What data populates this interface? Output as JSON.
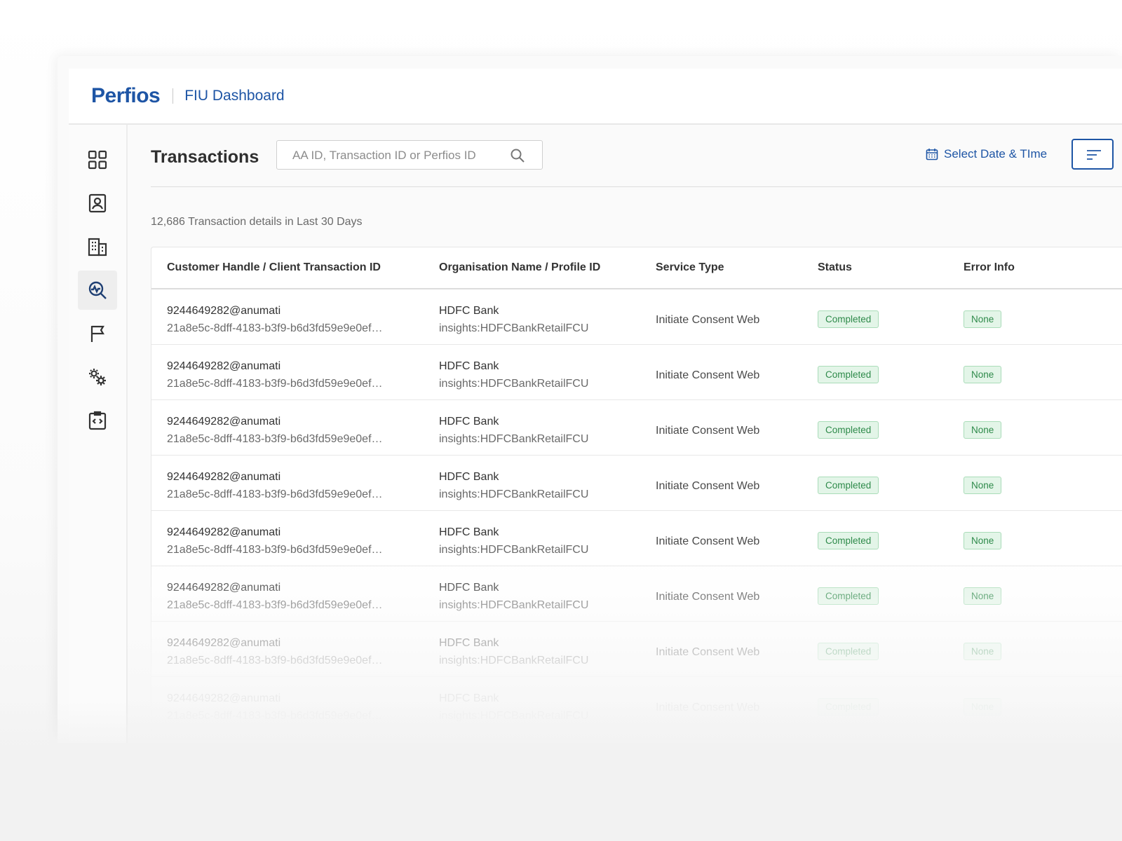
{
  "header": {
    "logo_text": "Perfios",
    "app_title": "FIU Dashboard"
  },
  "sidebar": {
    "items": [
      {
        "name": "dashboard",
        "icon": "grid-icon",
        "active": false
      },
      {
        "name": "customers",
        "icon": "user-profile-icon",
        "active": false
      },
      {
        "name": "organisations",
        "icon": "building-icon",
        "active": false
      },
      {
        "name": "transactions",
        "icon": "transaction-search-icon",
        "active": true
      },
      {
        "name": "reports",
        "icon": "flag-icon",
        "active": false
      },
      {
        "name": "settings",
        "icon": "gears-icon",
        "active": false
      },
      {
        "name": "developer",
        "icon": "code-clipboard-icon",
        "active": false
      }
    ]
  },
  "main": {
    "page_title": "Transactions",
    "search_placeholder": "AA ID, Transaction ID or Perfios ID",
    "date_button_label": "Select Date & TIme",
    "summary": "12,686 Transaction details in Last 30 Days"
  },
  "table": {
    "columns": [
      "Customer Handle / Client Transaction ID",
      "Organisation Name / Profile ID",
      "Service Type",
      "Status",
      "Error Info"
    ],
    "rows": [
      {
        "handle": "9244649282@anumati",
        "txn_id": "21a8e5c-8dff-4183-b3f9-b6d3fd59e9e0ef…",
        "org": "HDFC Bank",
        "profile": "insights:HDFCBankRetailFCU",
        "service": "Initiate Consent Web",
        "status": "Completed",
        "error": "None"
      },
      {
        "handle": "9244649282@anumati",
        "txn_id": "21a8e5c-8dff-4183-b3f9-b6d3fd59e9e0ef…",
        "org": "HDFC Bank",
        "profile": "insights:HDFCBankRetailFCU",
        "service": "Initiate Consent Web",
        "status": "Completed",
        "error": "None"
      },
      {
        "handle": "9244649282@anumati",
        "txn_id": "21a8e5c-8dff-4183-b3f9-b6d3fd59e9e0ef…",
        "org": "HDFC Bank",
        "profile": "insights:HDFCBankRetailFCU",
        "service": "Initiate Consent Web",
        "status": "Completed",
        "error": "None"
      },
      {
        "handle": "9244649282@anumati",
        "txn_id": "21a8e5c-8dff-4183-b3f9-b6d3fd59e9e0ef…",
        "org": "HDFC Bank",
        "profile": "insights:HDFCBankRetailFCU",
        "service": "Initiate Consent Web",
        "status": "Completed",
        "error": "None"
      },
      {
        "handle": "9244649282@anumati",
        "txn_id": "21a8e5c-8dff-4183-b3f9-b6d3fd59e9e0ef…",
        "org": "HDFC Bank",
        "profile": "insights:HDFCBankRetailFCU",
        "service": "Initiate Consent Web",
        "status": "Completed",
        "error": "None"
      },
      {
        "handle": "9244649282@anumati",
        "txn_id": "21a8e5c-8dff-4183-b3f9-b6d3fd59e9e0ef…",
        "org": "HDFC Bank",
        "profile": "insights:HDFCBankRetailFCU",
        "service": "Initiate Consent Web",
        "status": "Completed",
        "error": "None"
      },
      {
        "handle": "9244649282@anumati",
        "txn_id": "21a8e5c-8dff-4183-b3f9-b6d3fd59e9e0ef…",
        "org": "HDFC Bank",
        "profile": "insights:HDFCBankRetailFCU",
        "service": "Initiate Consent Web",
        "status": "Completed",
        "error": "None"
      },
      {
        "handle": "9244649282@anumati",
        "txn_id": "21a8e5c-8dff-4183-b3f9-b6d3fd59e9e0ef…",
        "org": "HDFC Bank",
        "profile": "insights:HDFCBankRetailFCU",
        "service": "Initiate Consent Web",
        "status": "Completed",
        "error": "None"
      }
    ]
  },
  "colors": {
    "brand": "#1e55a5",
    "success_text": "#2e8a4a",
    "success_bg": "#e3f5e8"
  }
}
